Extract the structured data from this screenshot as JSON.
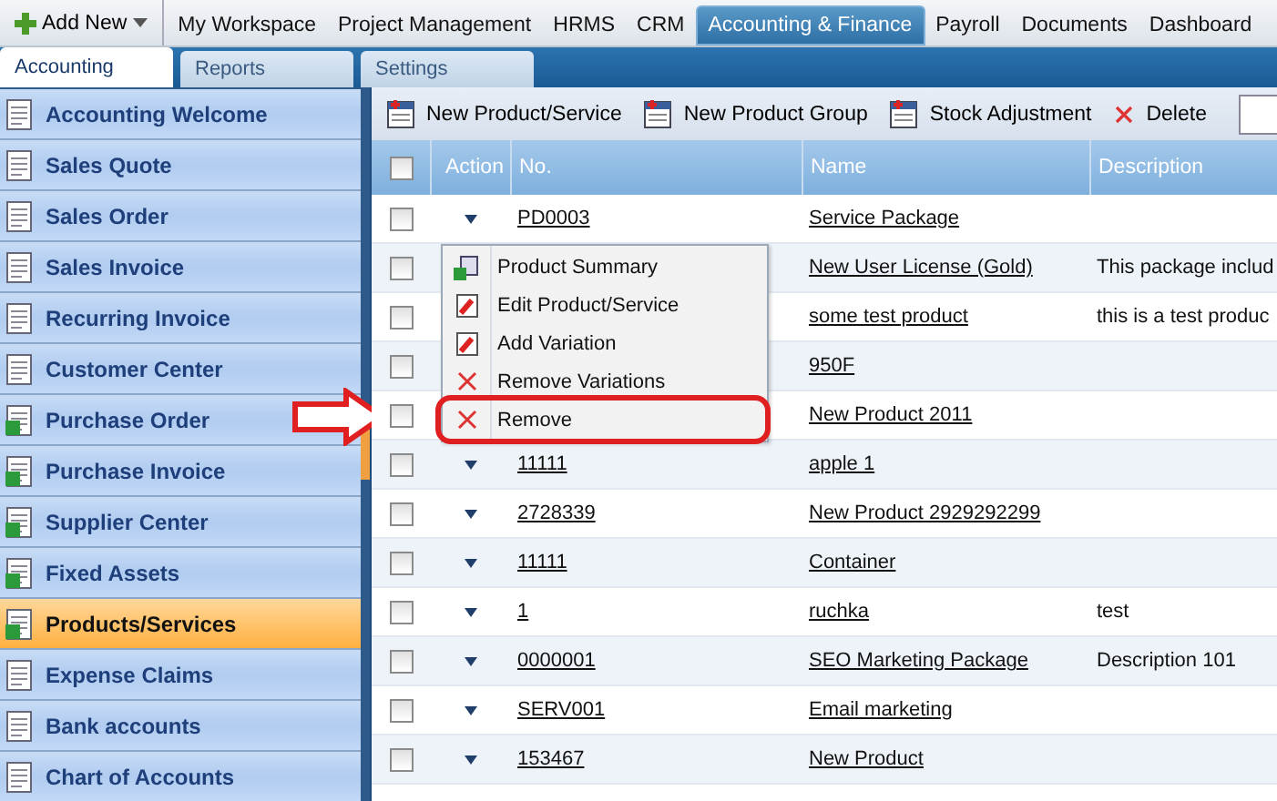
{
  "top_nav": {
    "add_new": "Add New",
    "items": [
      {
        "label": "My Workspace",
        "selected": false
      },
      {
        "label": "Project Management",
        "selected": false
      },
      {
        "label": "HRMS",
        "selected": false
      },
      {
        "label": "CRM",
        "selected": false
      },
      {
        "label": "Accounting & Finance",
        "selected": true
      },
      {
        "label": "Payroll",
        "selected": false
      },
      {
        "label": "Documents",
        "selected": false
      },
      {
        "label": "Dashboard",
        "selected": false
      }
    ]
  },
  "sub_tabs": [
    {
      "label": "Accounting",
      "selected": true
    },
    {
      "label": "Reports",
      "selected": false
    },
    {
      "label": "Settings",
      "selected": false
    }
  ],
  "sidebar": {
    "items": [
      {
        "label": "Accounting Welcome",
        "selected": false
      },
      {
        "label": "Sales Quote",
        "selected": false
      },
      {
        "label": "Sales Order",
        "selected": false
      },
      {
        "label": "Sales Invoice",
        "selected": false
      },
      {
        "label": "Recurring Invoice",
        "selected": false
      },
      {
        "label": "Customer Center",
        "selected": false
      },
      {
        "label": "Purchase Order",
        "selected": false
      },
      {
        "label": "Purchase Invoice",
        "selected": false
      },
      {
        "label": "Supplier Center",
        "selected": false
      },
      {
        "label": "Fixed Assets",
        "selected": false
      },
      {
        "label": "Products/Services",
        "selected": true
      },
      {
        "label": "Expense Claims",
        "selected": false
      },
      {
        "label": "Bank accounts",
        "selected": false
      },
      {
        "label": "Chart of Accounts",
        "selected": false
      }
    ]
  },
  "toolbar": [
    {
      "label": "New Product/Service",
      "kind": "add"
    },
    {
      "label": "New Product Group",
      "kind": "add"
    },
    {
      "label": "Stock Adjustment",
      "kind": "add"
    },
    {
      "label": "Delete",
      "kind": "delete"
    }
  ],
  "table": {
    "all_checked": false,
    "columns": [
      "Action",
      "No.",
      "Name",
      "Description"
    ],
    "rows": [
      {
        "checked": false,
        "no": "PD0003",
        "name": "Service Package",
        "description": ""
      },
      {
        "checked": false,
        "no": "",
        "name": "New User License (Gold)",
        "description": "This package includ"
      },
      {
        "checked": false,
        "no": "",
        "name": "some test product",
        "description": "this is a test produc"
      },
      {
        "checked": false,
        "no": "",
        "name": "950F",
        "description": ""
      },
      {
        "checked": false,
        "no": "",
        "name": "New Product 2011",
        "description": ""
      },
      {
        "checked": false,
        "no": "11111",
        "name": "apple 1",
        "description": ""
      },
      {
        "checked": false,
        "no": "2728339",
        "name": "New Product 2929292299",
        "description": ""
      },
      {
        "checked": false,
        "no": "11111",
        "name": "Container",
        "description": ""
      },
      {
        "checked": false,
        "no": "1",
        "name": "ruchka",
        "description": "test"
      },
      {
        "checked": false,
        "no": "0000001",
        "name": "SEO Marketing Package",
        "description": "Description 101"
      },
      {
        "checked": false,
        "no": "SERV001",
        "name": "Email marketing",
        "description": ""
      },
      {
        "checked": false,
        "no": "153467",
        "name": "New Product",
        "description": ""
      }
    ]
  },
  "action_menu": {
    "items": [
      {
        "label": "Product Summary",
        "kind": "summary",
        "highlighted": false
      },
      {
        "label": "Edit Product/Service",
        "kind": "edit",
        "highlighted": false
      },
      {
        "label": "Add Variation",
        "kind": "edit",
        "highlighted": false
      },
      {
        "label": "Remove Variations",
        "kind": "remove",
        "highlighted": false
      },
      {
        "label": "Remove",
        "kind": "remove",
        "highlighted": true
      }
    ]
  }
}
